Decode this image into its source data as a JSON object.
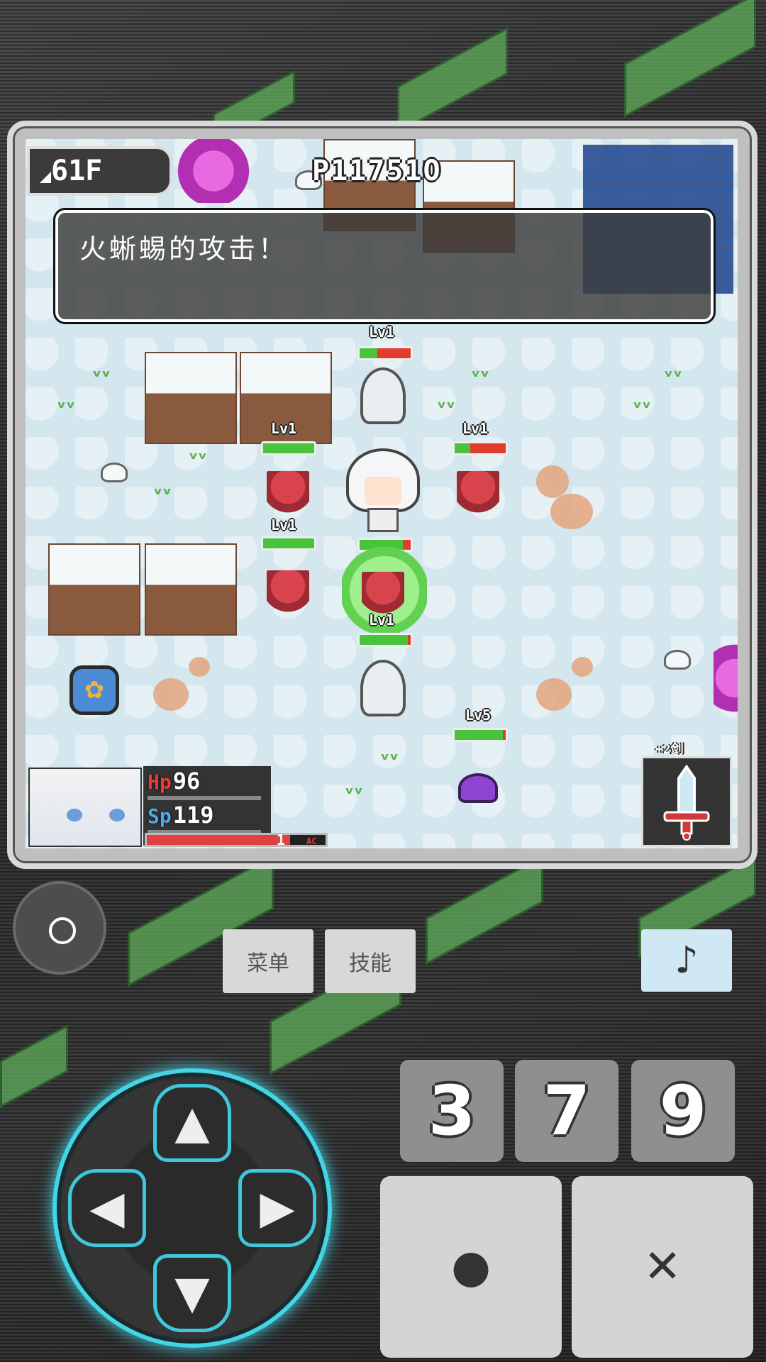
{
  "hud": {
    "floor": "61F",
    "gold": "P11751O"
  },
  "message": "火蜥蜴的攻击！",
  "units": [
    {
      "id": "ghost-top",
      "level": "Lv1",
      "hp_fraction": 0.35
    },
    {
      "id": "scorpion-left-a",
      "level": "Lv1",
      "hp_fraction": 1.0
    },
    {
      "id": "scorpion-right",
      "level": "Lv1",
      "hp_fraction": 0.3
    },
    {
      "id": "scorpion-left-b",
      "level": "Lv1",
      "hp_fraction": 1.0
    },
    {
      "id": "hero",
      "level": "",
      "hp_fraction": 0.85
    },
    {
      "id": "scorpion-center",
      "level": "Lv1",
      "hp_fraction": 0.95
    },
    {
      "id": "slime",
      "level": "Lv5",
      "hp_fraction": 0.95
    }
  ],
  "status": {
    "hp_label": "Hp",
    "hp_value": "96",
    "sp_label": "Sp",
    "sp_value": "119",
    "hunger_value": "1",
    "hunger_fraction": 0.8,
    "hunger_unit": "AC",
    "weapon_label": "+2剑"
  },
  "controls": {
    "menu": "菜单",
    "skill": "技能",
    "music_icon": "♪",
    "num1": "3",
    "num2": "7",
    "num3": "9",
    "confirm_symbol": "●",
    "cancel_symbol": "✕",
    "dpad_up": "▲",
    "dpad_down": "▼",
    "dpad_left": "◀",
    "dpad_right": "▶"
  },
  "colors": {
    "dpad_glow": "#43d4e6",
    "hp_red": "#e83b3b",
    "sp_blue": "#4fa8e8",
    "hp_bar_green": "#48c43c"
  }
}
